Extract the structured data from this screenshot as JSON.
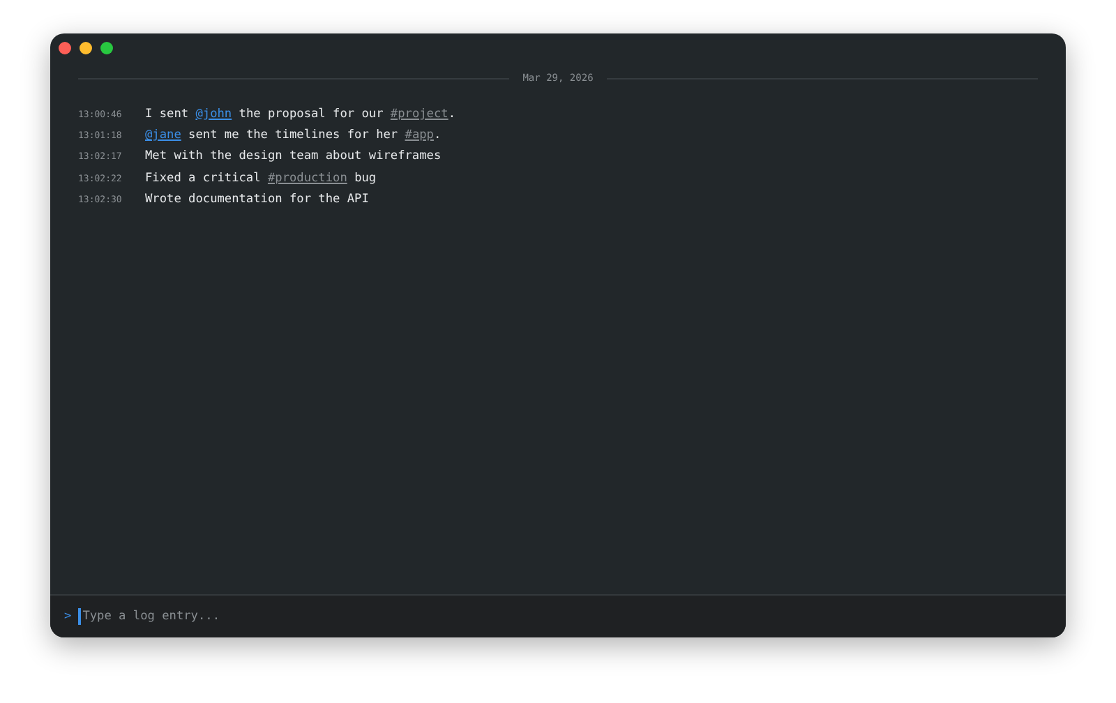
{
  "date_divider": "Mar 29, 2026",
  "entries": [
    {
      "time": "13:00:46",
      "segments": [
        {
          "kind": "text",
          "text": "I sent "
        },
        {
          "kind": "mention",
          "text": "@john"
        },
        {
          "kind": "text",
          "text": " the proposal for our "
        },
        {
          "kind": "tag",
          "text": "#project"
        },
        {
          "kind": "text",
          "text": "."
        }
      ]
    },
    {
      "time": "13:01:18",
      "segments": [
        {
          "kind": "mention",
          "text": "@jane"
        },
        {
          "kind": "text",
          "text": " sent me the timelines for her "
        },
        {
          "kind": "tag",
          "text": "#app"
        },
        {
          "kind": "text",
          "text": "."
        }
      ]
    },
    {
      "time": "13:02:17",
      "segments": [
        {
          "kind": "text",
          "text": "Met with the design team about wireframes"
        }
      ]
    },
    {
      "time": "13:02:22",
      "segments": [
        {
          "kind": "text",
          "text": "Fixed a critical "
        },
        {
          "kind": "tag",
          "text": "#production"
        },
        {
          "kind": "text",
          "text": " bug"
        }
      ]
    },
    {
      "time": "13:02:30",
      "segments": [
        {
          "kind": "text",
          "text": "Wrote documentation for the API"
        }
      ]
    }
  ],
  "input": {
    "prompt": ">",
    "placeholder": "Type a log entry..."
  }
}
